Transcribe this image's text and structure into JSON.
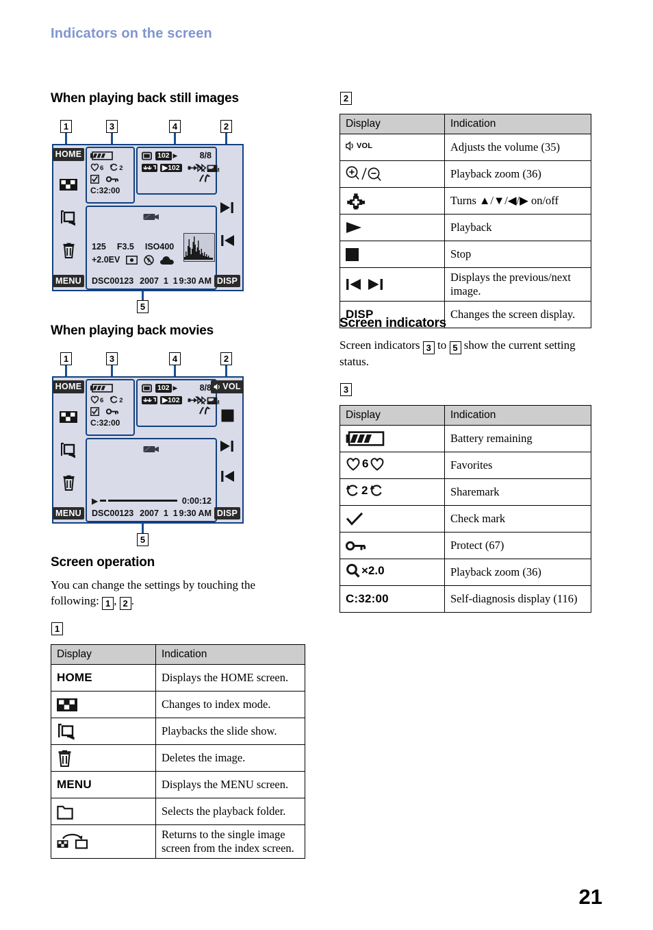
{
  "chapter_title": "Indicators on the screen",
  "page_number": "21",
  "sections": {
    "still": {
      "heading": "When playing back still images",
      "callouts_top": [
        "1",
        "3",
        "4",
        "2"
      ],
      "callout_bottom": "5"
    },
    "movies": {
      "heading": "When playing back movies",
      "callouts_top": [
        "1",
        "3",
        "4",
        "2"
      ],
      "callout_bottom": "5"
    },
    "screen_operation": {
      "heading": "Screen operation",
      "text_before": "You can change the settings by touching the following: ",
      "ref_a": "1",
      "ref_sep": ", ",
      "ref_b": "2",
      "text_after": "."
    },
    "screen_indicators": {
      "heading": "Screen indicators",
      "text_before": "Screen indicators ",
      "ref_a": "3",
      "text_mid": " to ",
      "ref_b": "5",
      "text_after": " show the current setting status."
    }
  },
  "lcd_still": {
    "left_buttons": [
      "HOME",
      "index-icon",
      "slideshow-icon",
      "trash-icon",
      "MENU"
    ],
    "right_buttons": [
      "next-image-icon",
      "prev-image-icon",
      "DISP"
    ],
    "status_group": {
      "battery": "battery-icon",
      "favorites_count": "6",
      "sharemark_count": "2",
      "check": "check-icon",
      "protect": "key-icon",
      "self_diagnosis": "C:32:00"
    },
    "info_group": {
      "media_icon": "memory-card-icon",
      "folder": "102",
      "counter": "8/8",
      "rec_folder_icon": "rec-folder-icon",
      "rec_folder": "102",
      "pictbridge_off": "pictbridge-disabled-icon",
      "image_size": "3M",
      "vibration": "camera-shake-icon"
    },
    "image_group": {
      "movie_icon": "movie-icon",
      "shutter_speed": "125",
      "aperture": "F3.5",
      "iso": "ISO400",
      "ev": "+2.0EV",
      "metering": "spot-metering-icon",
      "flash": "flash-off-icon",
      "white_balance": "cloudy-wb-icon",
      "histogram": "histogram-icon",
      "file_name": "DSC00123",
      "date": "2007  1  1",
      "time": "9:30 AM"
    }
  },
  "lcd_movie": {
    "left_buttons": [
      "HOME",
      "index-icon",
      "slideshow-icon",
      "trash-icon",
      "MENU"
    ],
    "right_buttons": [
      "VOL",
      "stop-icon",
      "next-image-icon",
      "prev-image-icon",
      "DISP"
    ],
    "status_group": {
      "battery": "battery-icon",
      "favorites_count": "6",
      "sharemark_count": "2",
      "check": "check-icon",
      "protect": "key-icon",
      "self_diagnosis": "C:32:00"
    },
    "info_group": {
      "media_icon": "memory-card-icon",
      "folder": "102",
      "counter": "8/8",
      "rec_folder_icon": "rec-folder-icon",
      "rec_folder": "102",
      "pictbridge_off": "pictbridge-disabled-icon",
      "image_size": "3M",
      "vibration": "camera-shake-icon"
    },
    "image_group": {
      "movie_icon": "movie-icon",
      "elapsed_time": "0:00:12",
      "file_name": "DSC00123",
      "date": "2007  1  1",
      "time": "9:30 AM"
    }
  },
  "table1": {
    "label": "1",
    "headers": [
      "Display",
      "Indication"
    ],
    "rows": [
      {
        "display_text": "HOME",
        "display_icon": null,
        "indication": "Displays the HOME screen."
      },
      {
        "display_text": null,
        "display_icon": "index-icon",
        "indication": "Changes to index mode."
      },
      {
        "display_text": null,
        "display_icon": "slideshow-icon",
        "indication": "Playbacks the slide show."
      },
      {
        "display_text": null,
        "display_icon": "trash-icon",
        "indication": "Deletes the image."
      },
      {
        "display_text": "MENU",
        "display_icon": null,
        "indication": "Displays the MENU screen."
      },
      {
        "display_text": null,
        "display_icon": "folder-icon",
        "indication": "Selects the playback folder."
      },
      {
        "display_text": null,
        "display_icon": "return-single-image-icon",
        "indication": "Returns to the single image screen from the index screen."
      }
    ]
  },
  "table2": {
    "label": "2",
    "headers": [
      "Display",
      "Indication"
    ],
    "rows": [
      {
        "display_text": null,
        "display_icon": "volume-icon",
        "indication": "Adjusts the volume (35)"
      },
      {
        "display_text": null,
        "display_icon": "zoom-in-out-icon",
        "indication": "Playback zoom (36)"
      },
      {
        "display_text": null,
        "display_icon": "control-pad-icon",
        "indication": "Turns ▲/▼/◀/▶ on/off"
      },
      {
        "display_text": null,
        "display_icon": "play-icon",
        "indication": "Playback"
      },
      {
        "display_text": null,
        "display_icon": "stop-icon",
        "indication": "Stop"
      },
      {
        "display_text": null,
        "display_icon": "prev-next-icon",
        "indication": "Displays the previous/next image."
      },
      {
        "display_text": "DISP",
        "display_icon": null,
        "indication": "Changes the screen display."
      }
    ]
  },
  "table3": {
    "label": "3",
    "headers": [
      "Display",
      "Indication"
    ],
    "rows": [
      {
        "display_text": null,
        "display_icon": "battery-icon",
        "indication": "Battery remaining"
      },
      {
        "display_text": null,
        "display_icon": "favorites-icon",
        "indication": "Favorites",
        "value": "6"
      },
      {
        "display_text": null,
        "display_icon": "sharemark-icon",
        "indication": "Sharemark",
        "value": "2"
      },
      {
        "display_text": null,
        "display_icon": "check-icon",
        "indication": "Check mark"
      },
      {
        "display_text": null,
        "display_icon": "key-icon",
        "indication": "Protect (67)"
      },
      {
        "display_text": null,
        "display_icon": "playback-zoom-icon",
        "indication": "Playback zoom (36)",
        "value": "×2.0"
      },
      {
        "display_text": "C:32:00",
        "display_icon": null,
        "indication": "Self-diagnosis display (116)"
      }
    ]
  }
}
